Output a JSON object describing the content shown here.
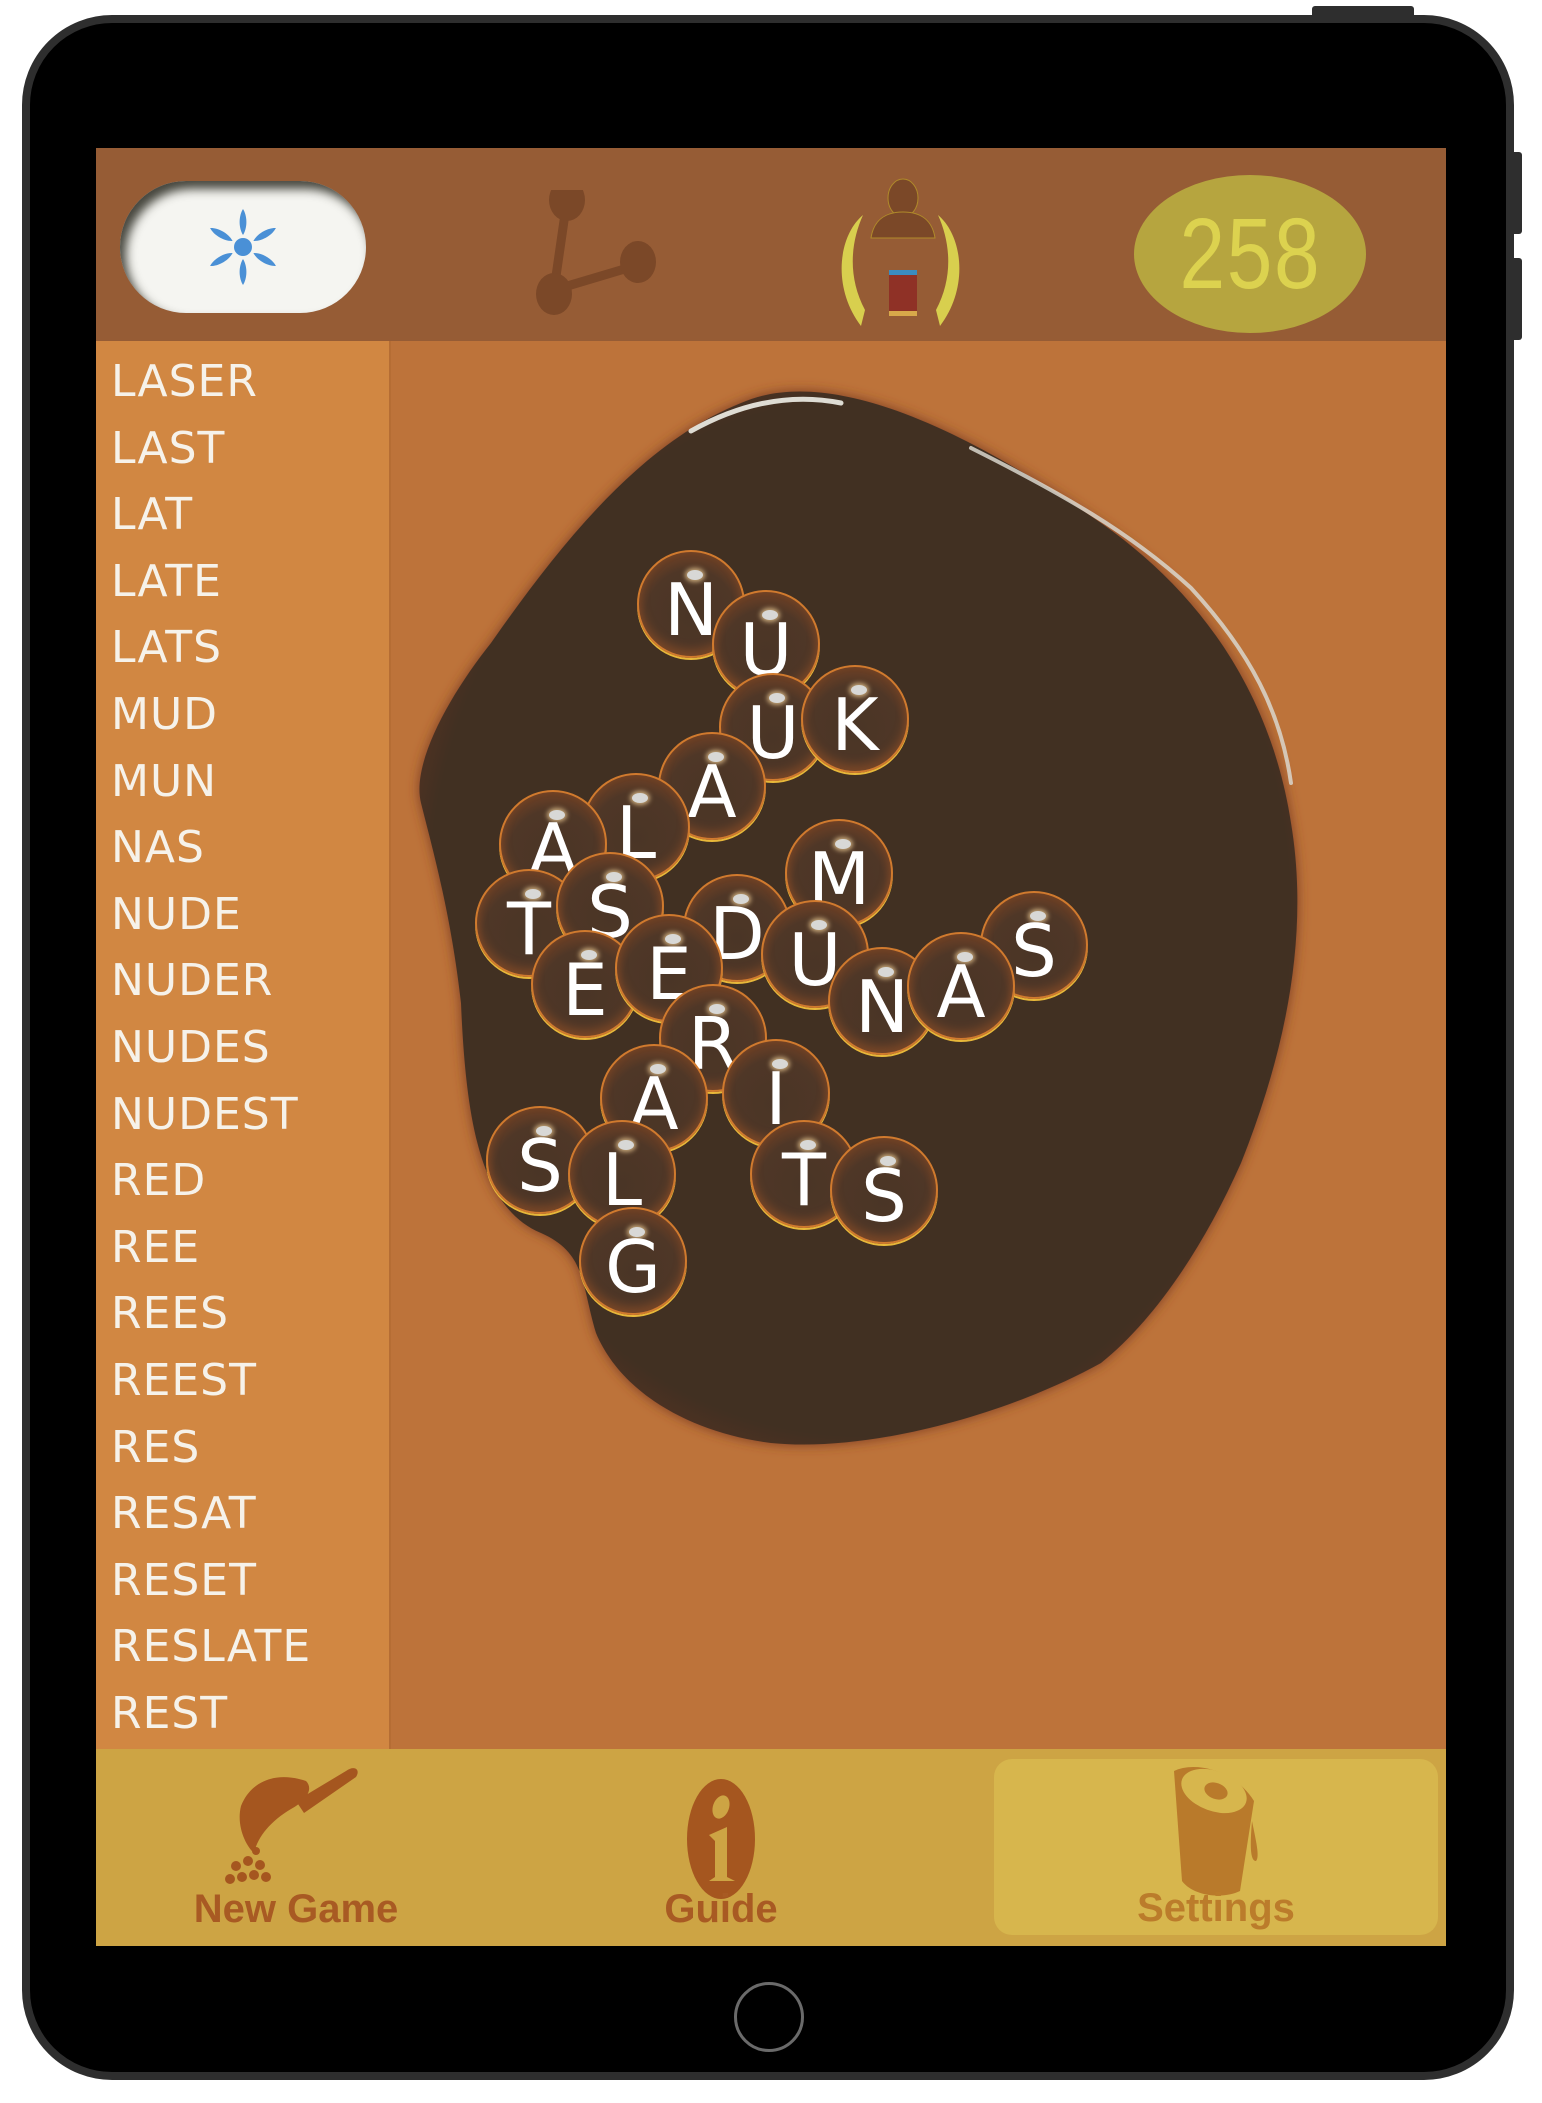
{
  "header": {
    "hint_button": {
      "icon": "asterisk-flower-icon",
      "color": "#4a90d6"
    },
    "share_button": {
      "icon": "share-nodes-icon"
    },
    "profile_button": {
      "icon": "profile-leaderboard-icon"
    },
    "score": "258"
  },
  "found_words": [
    "LASER",
    "LAST",
    "LAT",
    "LATE",
    "LATS",
    "MUD",
    "MUN",
    "NAS",
    "NUDE",
    "NUDER",
    "NUDES",
    "NUDEST",
    "RED",
    "REE",
    "REES",
    "REEST",
    "RES",
    "RESAT",
    "RESET",
    "RESLATE",
    "REST"
  ],
  "board": {
    "tiles": [
      {
        "letter": "N"
      },
      {
        "letter": "U"
      },
      {
        "letter": "U"
      },
      {
        "letter": "K"
      },
      {
        "letter": "A"
      },
      {
        "letter": "L"
      },
      {
        "letter": "A"
      },
      {
        "letter": "M"
      },
      {
        "letter": "T"
      },
      {
        "letter": "S"
      },
      {
        "letter": "D"
      },
      {
        "letter": "U"
      },
      {
        "letter": "S"
      },
      {
        "letter": "E"
      },
      {
        "letter": "E"
      },
      {
        "letter": "N"
      },
      {
        "letter": "A"
      },
      {
        "letter": "R"
      },
      {
        "letter": "A"
      },
      {
        "letter": "I"
      },
      {
        "letter": "S"
      },
      {
        "letter": "L"
      },
      {
        "letter": "T"
      },
      {
        "letter": "S"
      },
      {
        "letter": "G"
      }
    ]
  },
  "bottom_nav": {
    "new_game": {
      "label": "New Game",
      "icon": "scoop-pour-icon"
    },
    "guide": {
      "label": "Guide",
      "icon": "info-icon"
    },
    "settings": {
      "label": "Settings",
      "icon": "cup-icon",
      "active": true
    }
  },
  "colors": {
    "topbar": "#965c35",
    "wordlist": "#d18742",
    "board_bg": "#bd733a",
    "puddle": "#413022",
    "score_oval": "#b6a53f",
    "score_text": "#dcd24f",
    "bottombar": "#cda444",
    "nav_icon": "#a5561f"
  }
}
